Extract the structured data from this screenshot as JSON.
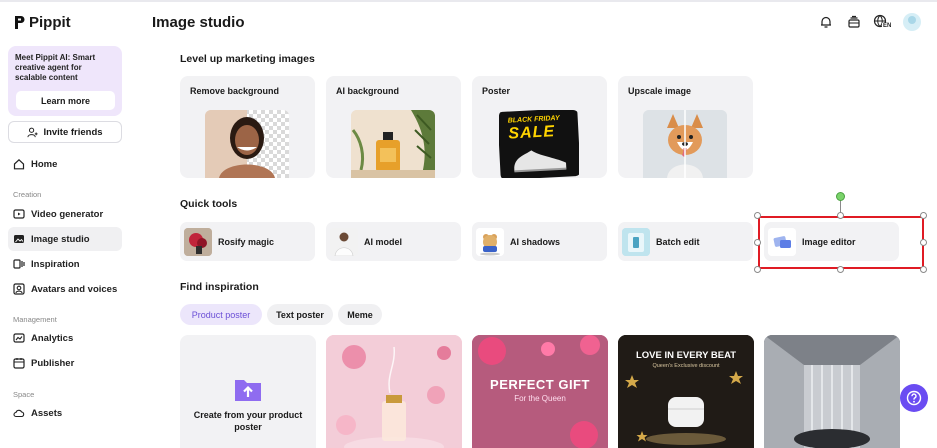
{
  "brand": {
    "name": "Pippit"
  },
  "promo": {
    "text": "Meet Pippit AI: Smart creative agent for scalable content",
    "button": "Learn more"
  },
  "invite": {
    "label": "Invite friends"
  },
  "nav": {
    "home": "Home",
    "creation_label": "Creation",
    "video_generator": "Video generator",
    "image_studio": "Image studio",
    "inspiration": "Inspiration",
    "avatars": "Avatars and voices",
    "management_label": "Management",
    "analytics": "Analytics",
    "publisher": "Publisher",
    "space_label": "Space",
    "assets": "Assets"
  },
  "header": {
    "title": "Image studio",
    "lang_badge": "EN"
  },
  "marketing": {
    "title": "Level up marketing images",
    "cards": [
      {
        "label": "Remove background"
      },
      {
        "label": "AI background"
      },
      {
        "label": "Poster",
        "poster_line1": "BLACK FRIDAY",
        "poster_line2": "SALE"
      },
      {
        "label": "Upscale image"
      }
    ]
  },
  "quick_tools": {
    "title": "Quick tools",
    "items": [
      {
        "label": "Rosify magic"
      },
      {
        "label": "AI model"
      },
      {
        "label": "AI shadows"
      },
      {
        "label": "Batch edit"
      },
      {
        "label": "Image editor"
      }
    ]
  },
  "inspiration": {
    "title": "Find inspiration",
    "chips": [
      "Product poster",
      "Text poster",
      "Meme"
    ],
    "active_chip": "Product poster",
    "create_label": "Create from your product poster",
    "cards": [
      {
        "headline": "PERFECT GIFT",
        "sub": "For the Queen"
      },
      {
        "headline": "LOVE IN EVERY BEAT",
        "sub": "Queen's Exclusive discount"
      }
    ]
  },
  "colors": {
    "accent": "#6a4cf2",
    "selection": "#e01b24",
    "promo_bg": "#efe6fb"
  }
}
